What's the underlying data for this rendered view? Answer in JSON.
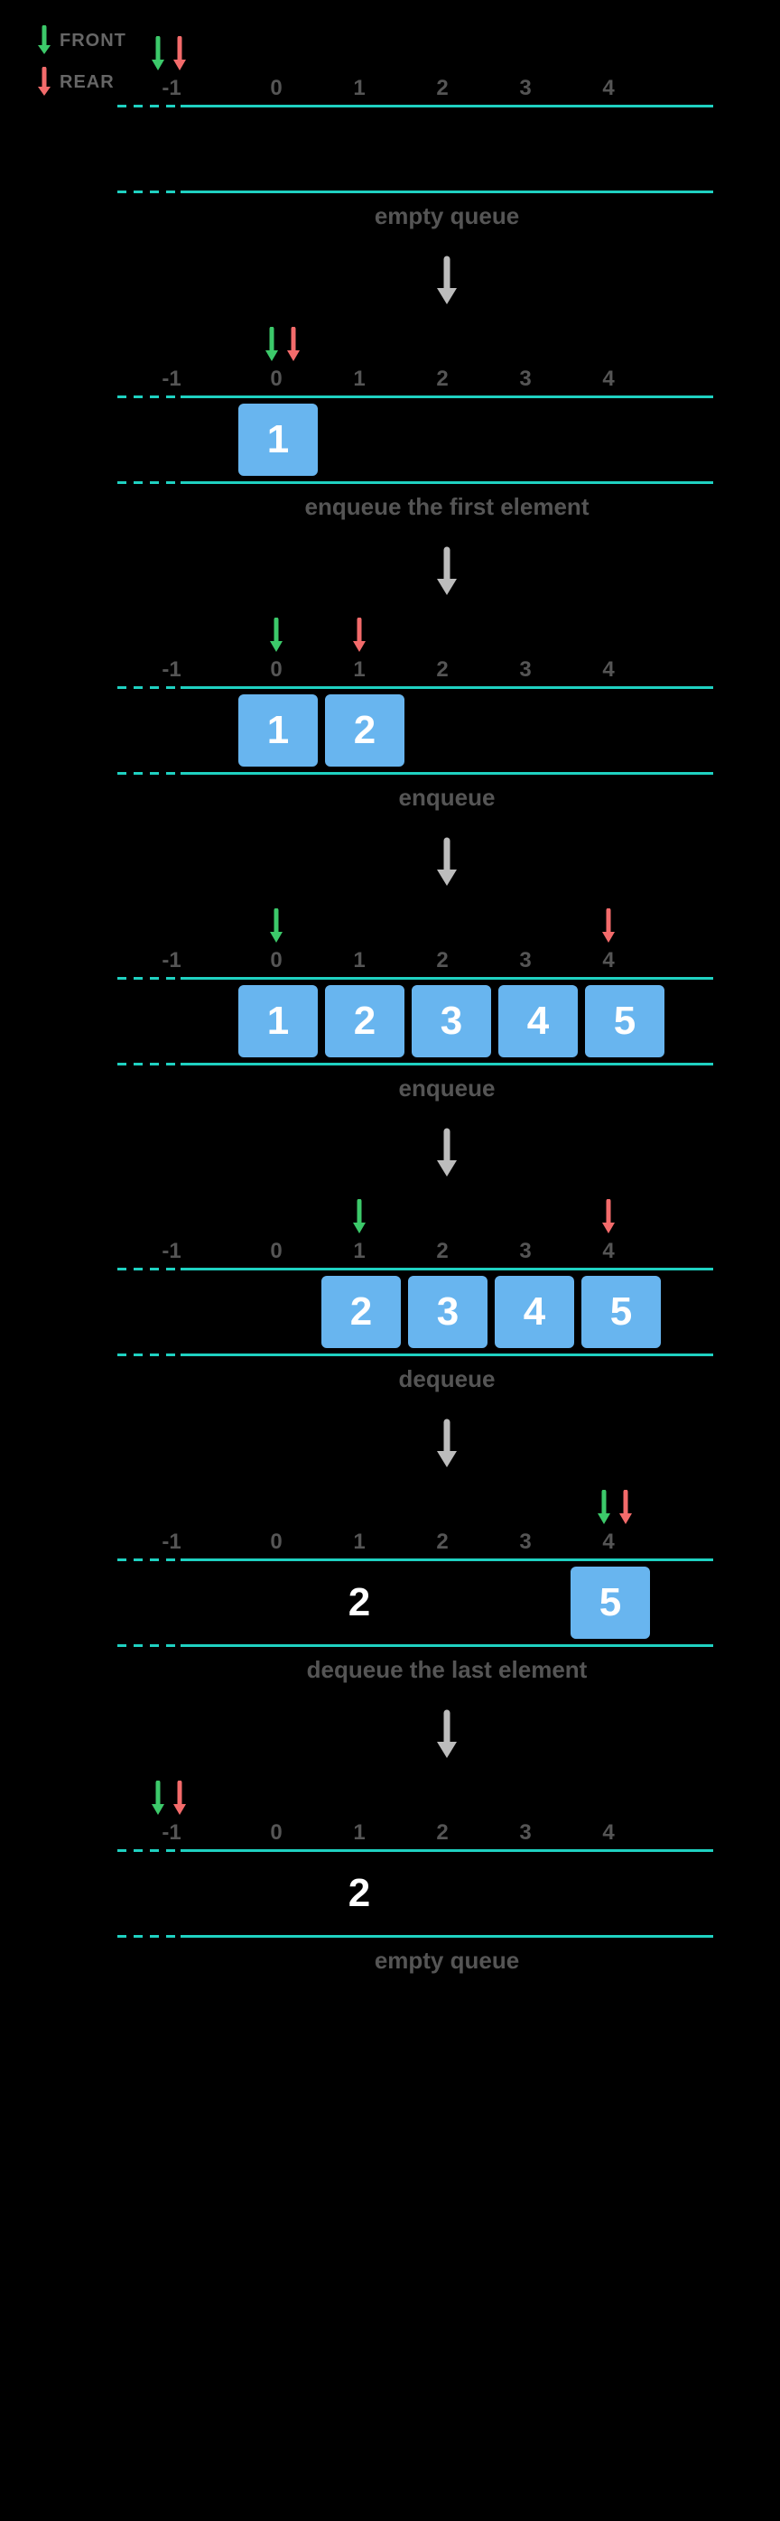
{
  "legend": {
    "front": "FRONT",
    "rear": "REAR"
  },
  "colors": {
    "front": "#3cc96a",
    "rear": "#f36b6b",
    "axis": "#1fd1c1",
    "cell": "#68b5ef",
    "transition": "#bcbcbc"
  },
  "indices": [
    "-1",
    "0",
    "1",
    "2",
    "3",
    "4"
  ],
  "steps": [
    {
      "front_col": -1,
      "rear_col": -1,
      "pair": true,
      "cells": [
        null,
        null,
        null,
        null,
        null
      ],
      "caption": "empty queue"
    },
    {
      "front_col": 0,
      "rear_col": 0,
      "pair": true,
      "cells": [
        "1",
        null,
        null,
        null,
        null
      ],
      "caption": "enqueue the first element"
    },
    {
      "front_col": 0,
      "rear_col": 1,
      "pair": false,
      "cells": [
        "1",
        "2",
        null,
        null,
        null
      ],
      "caption": "enqueue"
    },
    {
      "front_col": 0,
      "rear_col": 4,
      "pair": false,
      "cells": [
        "1",
        "2",
        "3",
        "4",
        "5"
      ],
      "caption": "enqueue"
    },
    {
      "front_col": 1,
      "rear_col": 4,
      "pair": false,
      "cells": [
        null,
        "2",
        "3",
        "4",
        "5"
      ],
      "caption": "dequeue"
    },
    {
      "front_col": 4,
      "rear_col": 4,
      "pair": true,
      "ghost_at": 1,
      "ghost_val": "2",
      "cells": [
        null,
        null,
        null,
        null,
        "5"
      ],
      "caption": "dequeue the last element"
    },
    {
      "front_col": -1,
      "rear_col": -1,
      "pair": true,
      "ghost_at": 1,
      "ghost_val": "2",
      "cells": [
        null,
        null,
        null,
        null,
        null
      ],
      "caption": "empty queue"
    }
  ]
}
